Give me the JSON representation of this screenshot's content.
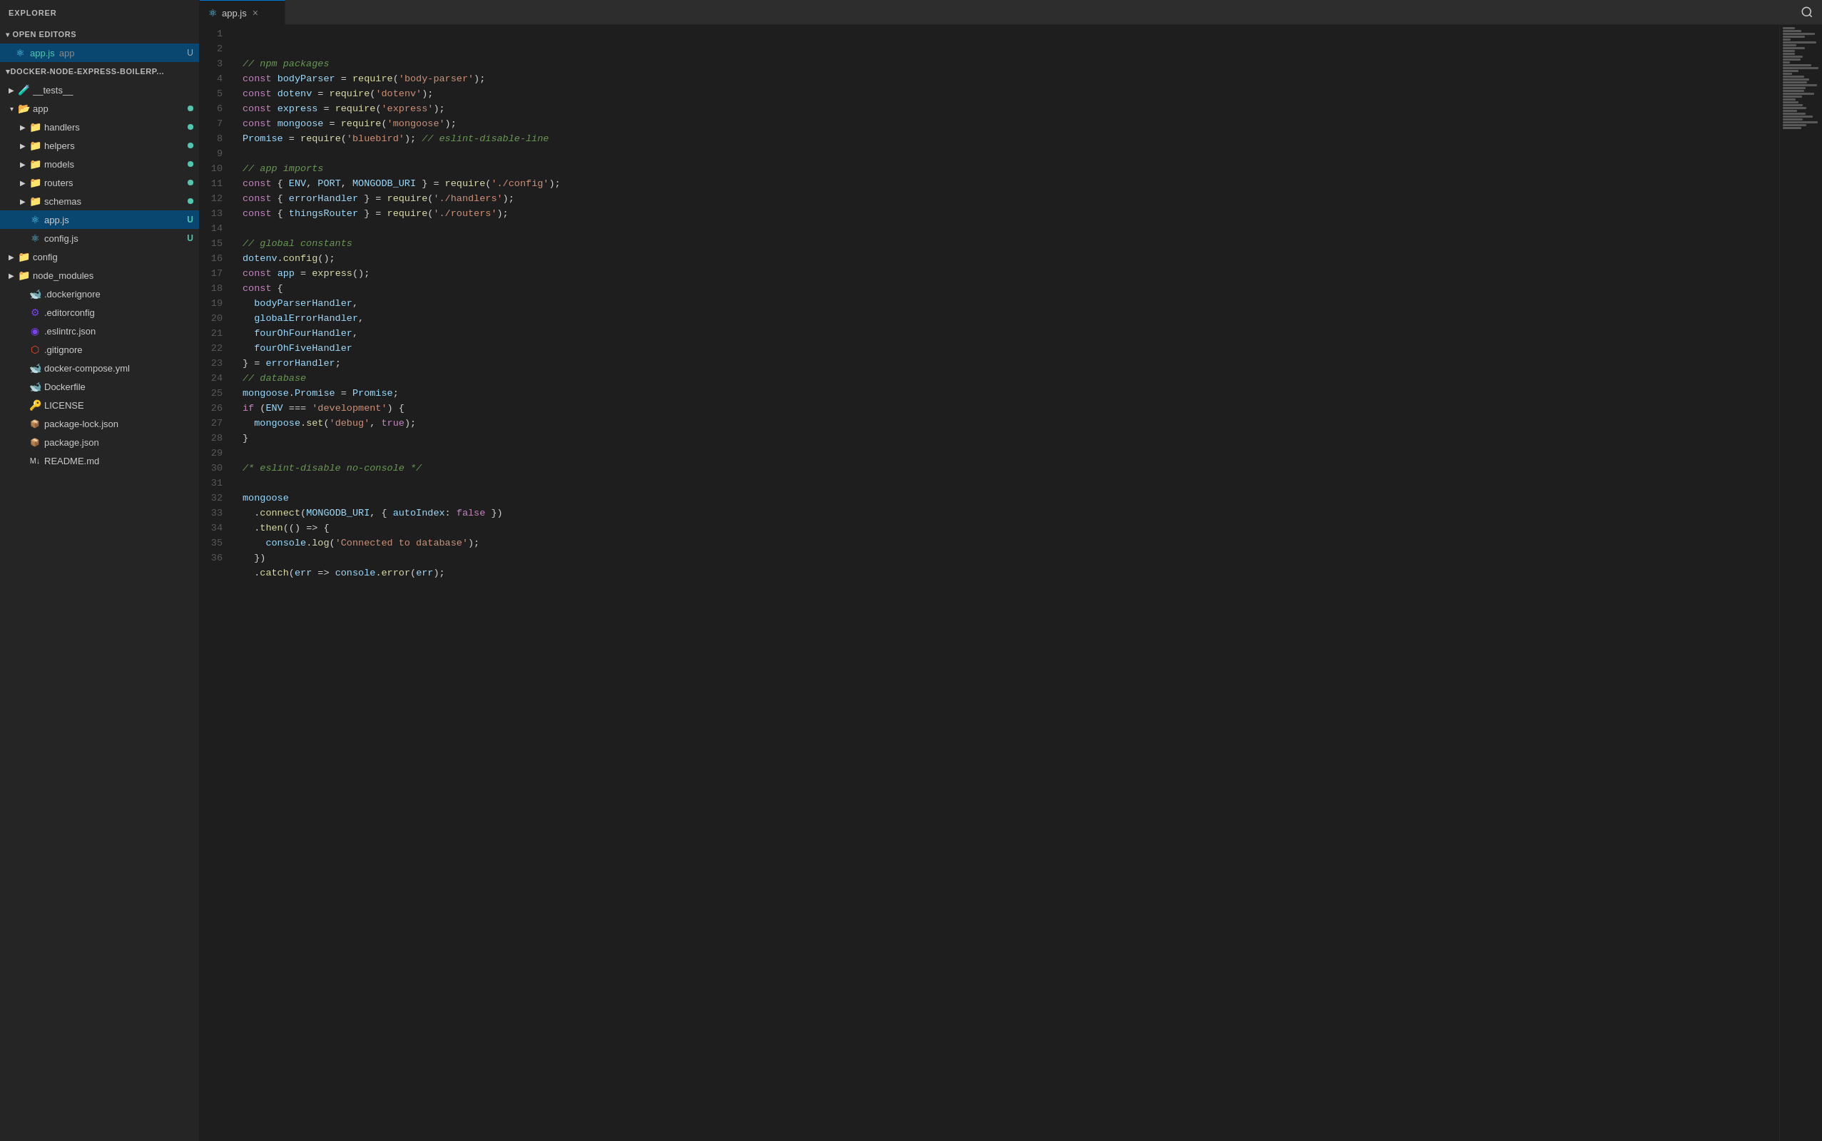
{
  "sidebar": {
    "title": "EXPLORER",
    "open_editors_label": "OPEN EDITORS",
    "open_file": {
      "icon": "react",
      "name": "app.js",
      "path": "app",
      "dirty": "U"
    },
    "project_label": "DOCKER-NODE-EXPRESS-BOILERP...",
    "tree": [
      {
        "id": "tests",
        "type": "folder",
        "label": "__tests__",
        "indent": 0,
        "expanded": false,
        "icon": "test-folder",
        "status": ""
      },
      {
        "id": "app",
        "type": "folder",
        "label": "app",
        "indent": 0,
        "expanded": true,
        "icon": "folder",
        "status": "dot-teal"
      },
      {
        "id": "handlers",
        "type": "folder",
        "label": "handlers",
        "indent": 1,
        "expanded": false,
        "icon": "folder",
        "status": "dot-teal"
      },
      {
        "id": "helpers",
        "type": "folder",
        "label": "helpers",
        "indent": 1,
        "expanded": false,
        "icon": "folder",
        "status": "dot-teal"
      },
      {
        "id": "models",
        "type": "folder",
        "label": "models",
        "indent": 1,
        "expanded": false,
        "icon": "folder",
        "status": "dot-teal"
      },
      {
        "id": "routers",
        "type": "folder",
        "label": "routers",
        "indent": 1,
        "expanded": false,
        "icon": "folder",
        "status": "dot-teal"
      },
      {
        "id": "schemas",
        "type": "folder",
        "label": "schemas",
        "indent": 1,
        "expanded": false,
        "icon": "folder",
        "status": "dot-teal"
      },
      {
        "id": "app-js",
        "type": "file",
        "label": "app.js",
        "indent": 1,
        "icon": "react-js",
        "status": "u-teal"
      },
      {
        "id": "config-js",
        "type": "file",
        "label": "config.js",
        "indent": 1,
        "icon": "react-js",
        "status": "u-teal"
      },
      {
        "id": "config",
        "type": "folder",
        "label": "config",
        "indent": 0,
        "expanded": false,
        "icon": "folder-config",
        "status": ""
      },
      {
        "id": "node-modules",
        "type": "folder",
        "label": "node_modules",
        "indent": 0,
        "expanded": false,
        "icon": "folder-nm",
        "status": ""
      },
      {
        "id": "dockerignore",
        "type": "file",
        "label": ".dockerignore",
        "indent": 0,
        "icon": "docker",
        "status": ""
      },
      {
        "id": "editorconfig",
        "type": "file",
        "label": ".editorconfig",
        "indent": 0,
        "icon": "editor",
        "status": ""
      },
      {
        "id": "eslintrc",
        "type": "file",
        "label": ".eslintrc.json",
        "indent": 0,
        "icon": "eslint",
        "status": ""
      },
      {
        "id": "gitignore",
        "type": "file",
        "label": ".gitignore",
        "indent": 0,
        "icon": "git",
        "status": ""
      },
      {
        "id": "docker-compose",
        "type": "file",
        "label": "docker-compose.yml",
        "indent": 0,
        "icon": "docker",
        "status": ""
      },
      {
        "id": "dockerfile",
        "type": "file",
        "label": "Dockerfile",
        "indent": 0,
        "icon": "docker",
        "status": ""
      },
      {
        "id": "license",
        "type": "file",
        "label": "LICENSE",
        "indent": 0,
        "icon": "license",
        "status": ""
      },
      {
        "id": "package-lock",
        "type": "file",
        "label": "package-lock.json",
        "indent": 0,
        "icon": "json-red",
        "status": ""
      },
      {
        "id": "package-json",
        "type": "file",
        "label": "package.json",
        "indent": 0,
        "icon": "json-red",
        "status": ""
      },
      {
        "id": "readme",
        "type": "file",
        "label": "README.md",
        "indent": 0,
        "icon": "md",
        "status": ""
      }
    ]
  },
  "editor": {
    "tab_name": "app.js",
    "lines": [
      {
        "num": 1,
        "tokens": [
          {
            "t": "comment",
            "v": "// npm packages"
          }
        ]
      },
      {
        "num": 2,
        "tokens": [
          {
            "t": "keyword",
            "v": "const"
          },
          {
            "t": "plain",
            "v": " "
          },
          {
            "t": "var",
            "v": "bodyParser"
          },
          {
            "t": "plain",
            "v": " = "
          },
          {
            "t": "func",
            "v": "require"
          },
          {
            "t": "plain",
            "v": "("
          },
          {
            "t": "string",
            "v": "'body-parser'"
          },
          {
            "t": "plain",
            "v": ");"
          }
        ]
      },
      {
        "num": 3,
        "tokens": [
          {
            "t": "keyword",
            "v": "const"
          },
          {
            "t": "plain",
            "v": " "
          },
          {
            "t": "var",
            "v": "dotenv"
          },
          {
            "t": "plain",
            "v": " = "
          },
          {
            "t": "func",
            "v": "require"
          },
          {
            "t": "plain",
            "v": "("
          },
          {
            "t": "string",
            "v": "'dotenv'"
          },
          {
            "t": "plain",
            "v": ");"
          }
        ]
      },
      {
        "num": 4,
        "tokens": [
          {
            "t": "keyword",
            "v": "const"
          },
          {
            "t": "plain",
            "v": " "
          },
          {
            "t": "var",
            "v": "express"
          },
          {
            "t": "plain",
            "v": " = "
          },
          {
            "t": "func",
            "v": "require"
          },
          {
            "t": "plain",
            "v": "("
          },
          {
            "t": "string",
            "v": "'express'"
          },
          {
            "t": "plain",
            "v": ");"
          }
        ]
      },
      {
        "num": 5,
        "tokens": [
          {
            "t": "keyword",
            "v": "const"
          },
          {
            "t": "plain",
            "v": " "
          },
          {
            "t": "var",
            "v": "mongoose"
          },
          {
            "t": "plain",
            "v": " = "
          },
          {
            "t": "func",
            "v": "require"
          },
          {
            "t": "plain",
            "v": "("
          },
          {
            "t": "string",
            "v": "'mongoose'"
          },
          {
            "t": "plain",
            "v": ");"
          }
        ]
      },
      {
        "num": 6,
        "tokens": [
          {
            "t": "var",
            "v": "Promise"
          },
          {
            "t": "plain",
            "v": " = "
          },
          {
            "t": "func",
            "v": "require"
          },
          {
            "t": "plain",
            "v": "("
          },
          {
            "t": "string",
            "v": "'bluebird'"
          },
          {
            "t": "plain",
            "v": "); "
          },
          {
            "t": "comment",
            "v": "// eslint-disable-line"
          }
        ]
      },
      {
        "num": 7,
        "tokens": [
          {
            "t": "plain",
            "v": ""
          }
        ]
      },
      {
        "num": 8,
        "tokens": [
          {
            "t": "comment",
            "v": "// app imports"
          }
        ]
      },
      {
        "num": 9,
        "tokens": [
          {
            "t": "keyword",
            "v": "const"
          },
          {
            "t": "plain",
            "v": " { "
          },
          {
            "t": "var",
            "v": "ENV"
          },
          {
            "t": "plain",
            "v": ", "
          },
          {
            "t": "var",
            "v": "PORT"
          },
          {
            "t": "plain",
            "v": ", "
          },
          {
            "t": "var",
            "v": "MONGODB_URI"
          },
          {
            "t": "plain",
            "v": " } = "
          },
          {
            "t": "func",
            "v": "require"
          },
          {
            "t": "plain",
            "v": "("
          },
          {
            "t": "string",
            "v": "'./config'"
          },
          {
            "t": "plain",
            "v": ");"
          }
        ]
      },
      {
        "num": 10,
        "tokens": [
          {
            "t": "keyword",
            "v": "const"
          },
          {
            "t": "plain",
            "v": " { "
          },
          {
            "t": "var",
            "v": "errorHandler"
          },
          {
            "t": "plain",
            "v": " } = "
          },
          {
            "t": "func",
            "v": "require"
          },
          {
            "t": "plain",
            "v": "("
          },
          {
            "t": "string",
            "v": "'./handlers'"
          },
          {
            "t": "plain",
            "v": ");"
          }
        ]
      },
      {
        "num": 11,
        "tokens": [
          {
            "t": "keyword",
            "v": "const"
          },
          {
            "t": "plain",
            "v": " { "
          },
          {
            "t": "var",
            "v": "thingsRouter"
          },
          {
            "t": "plain",
            "v": " } = "
          },
          {
            "t": "func",
            "v": "require"
          },
          {
            "t": "plain",
            "v": "("
          },
          {
            "t": "string",
            "v": "'./routers'"
          },
          {
            "t": "plain",
            "v": ");"
          }
        ]
      },
      {
        "num": 12,
        "tokens": [
          {
            "t": "plain",
            "v": ""
          }
        ]
      },
      {
        "num": 13,
        "tokens": [
          {
            "t": "comment",
            "v": "// global constants"
          }
        ]
      },
      {
        "num": 14,
        "tokens": [
          {
            "t": "var",
            "v": "dotenv"
          },
          {
            "t": "plain",
            "v": "."
          },
          {
            "t": "func",
            "v": "config"
          },
          {
            "t": "plain",
            "v": "();"
          }
        ]
      },
      {
        "num": 15,
        "tokens": [
          {
            "t": "keyword",
            "v": "const"
          },
          {
            "t": "plain",
            "v": " "
          },
          {
            "t": "var",
            "v": "app"
          },
          {
            "t": "plain",
            "v": " = "
          },
          {
            "t": "func",
            "v": "express"
          },
          {
            "t": "plain",
            "v": "();"
          }
        ]
      },
      {
        "num": 16,
        "tokens": [
          {
            "t": "keyword",
            "v": "const"
          },
          {
            "t": "plain",
            "v": " {"
          }
        ]
      },
      {
        "num": 17,
        "tokens": [
          {
            "t": "plain",
            "v": "  "
          },
          {
            "t": "var",
            "v": "bodyParserHandler"
          },
          {
            "t": "plain",
            "v": ","
          }
        ]
      },
      {
        "num": 18,
        "tokens": [
          {
            "t": "plain",
            "v": "  "
          },
          {
            "t": "var",
            "v": "globalErrorHandler"
          },
          {
            "t": "plain",
            "v": ","
          }
        ]
      },
      {
        "num": 19,
        "tokens": [
          {
            "t": "plain",
            "v": "  "
          },
          {
            "t": "var",
            "v": "fourOhFourHandler"
          },
          {
            "t": "plain",
            "v": ","
          }
        ]
      },
      {
        "num": 20,
        "tokens": [
          {
            "t": "plain",
            "v": "  "
          },
          {
            "t": "var",
            "v": "fourOhFiveHandler"
          }
        ]
      },
      {
        "num": 21,
        "tokens": [
          {
            "t": "plain",
            "v": "} = "
          },
          {
            "t": "var",
            "v": "errorHandler"
          },
          {
            "t": "plain",
            "v": ";"
          }
        ]
      },
      {
        "num": 22,
        "tokens": [
          {
            "t": "comment",
            "v": "// database"
          }
        ]
      },
      {
        "num": 23,
        "tokens": [
          {
            "t": "var",
            "v": "mongoose"
          },
          {
            "t": "plain",
            "v": "."
          },
          {
            "t": "var",
            "v": "Promise"
          },
          {
            "t": "plain",
            "v": " = "
          },
          {
            "t": "var",
            "v": "Promise"
          },
          {
            "t": "plain",
            "v": ";"
          }
        ]
      },
      {
        "num": 24,
        "tokens": [
          {
            "t": "keyword",
            "v": "if"
          },
          {
            "t": "plain",
            "v": " ("
          },
          {
            "t": "var",
            "v": "ENV"
          },
          {
            "t": "plain",
            "v": " "
          },
          {
            "t": "op",
            "v": "==="
          },
          {
            "t": "plain",
            "v": " "
          },
          {
            "t": "string",
            "v": "'development'"
          },
          {
            "t": "plain",
            "v": ") {"
          }
        ]
      },
      {
        "num": 25,
        "tokens": [
          {
            "t": "plain",
            "v": "  "
          },
          {
            "t": "var",
            "v": "mongoose"
          },
          {
            "t": "plain",
            "v": "."
          },
          {
            "t": "func",
            "v": "set"
          },
          {
            "t": "plain",
            "v": "("
          },
          {
            "t": "string",
            "v": "'debug'"
          },
          {
            "t": "plain",
            "v": ", "
          },
          {
            "t": "keyword",
            "v": "true"
          },
          {
            "t": "plain",
            "v": ");"
          }
        ]
      },
      {
        "num": 26,
        "tokens": [
          {
            "t": "plain",
            "v": "}"
          }
        ]
      },
      {
        "num": 27,
        "tokens": [
          {
            "t": "plain",
            "v": ""
          }
        ]
      },
      {
        "num": 28,
        "tokens": [
          {
            "t": "comment",
            "v": "/* eslint-disable no-console */"
          }
        ]
      },
      {
        "num": 29,
        "tokens": [
          {
            "t": "plain",
            "v": ""
          }
        ]
      },
      {
        "num": 30,
        "tokens": [
          {
            "t": "var",
            "v": "mongoose"
          }
        ]
      },
      {
        "num": 31,
        "tokens": [
          {
            "t": "plain",
            "v": "  ."
          },
          {
            "t": "func",
            "v": "connect"
          },
          {
            "t": "plain",
            "v": "("
          },
          {
            "t": "var",
            "v": "MONGODB_URI"
          },
          {
            "t": "plain",
            "v": ", { "
          },
          {
            "t": "var",
            "v": "autoIndex"
          },
          {
            "t": "plain",
            "v": ": "
          },
          {
            "t": "keyword",
            "v": "false"
          },
          {
            "t": "plain",
            "v": " })"
          }
        ]
      },
      {
        "num": 32,
        "tokens": [
          {
            "t": "plain",
            "v": "  ."
          },
          {
            "t": "func",
            "v": "then"
          },
          {
            "t": "plain",
            "v": "(() "
          },
          {
            "t": "op",
            "v": "=>"
          },
          {
            "t": "plain",
            "v": " {"
          }
        ]
      },
      {
        "num": 33,
        "tokens": [
          {
            "t": "plain",
            "v": "    "
          },
          {
            "t": "var",
            "v": "console"
          },
          {
            "t": "plain",
            "v": "."
          },
          {
            "t": "func",
            "v": "log"
          },
          {
            "t": "plain",
            "v": "("
          },
          {
            "t": "string",
            "v": "'Connected to database'"
          },
          {
            "t": "plain",
            "v": ");"
          }
        ]
      },
      {
        "num": 34,
        "tokens": [
          {
            "t": "plain",
            "v": "  })"
          }
        ]
      },
      {
        "num": 35,
        "tokens": [
          {
            "t": "plain",
            "v": "  ."
          },
          {
            "t": "func",
            "v": "catch"
          },
          {
            "t": "plain",
            "v": "("
          },
          {
            "t": "var",
            "v": "err"
          },
          {
            "t": "plain",
            "v": " "
          },
          {
            "t": "op",
            "v": "=>"
          },
          {
            "t": "plain",
            "v": " "
          },
          {
            "t": "var",
            "v": "console"
          },
          {
            "t": "plain",
            "v": "."
          },
          {
            "t": "func",
            "v": "error"
          },
          {
            "t": "plain",
            "v": "("
          },
          {
            "t": "var",
            "v": "err"
          },
          {
            "t": "plain",
            "v": ");"
          }
        ]
      },
      {
        "num": 36,
        "tokens": [
          {
            "t": "plain",
            "v": ""
          }
        ]
      }
    ]
  }
}
